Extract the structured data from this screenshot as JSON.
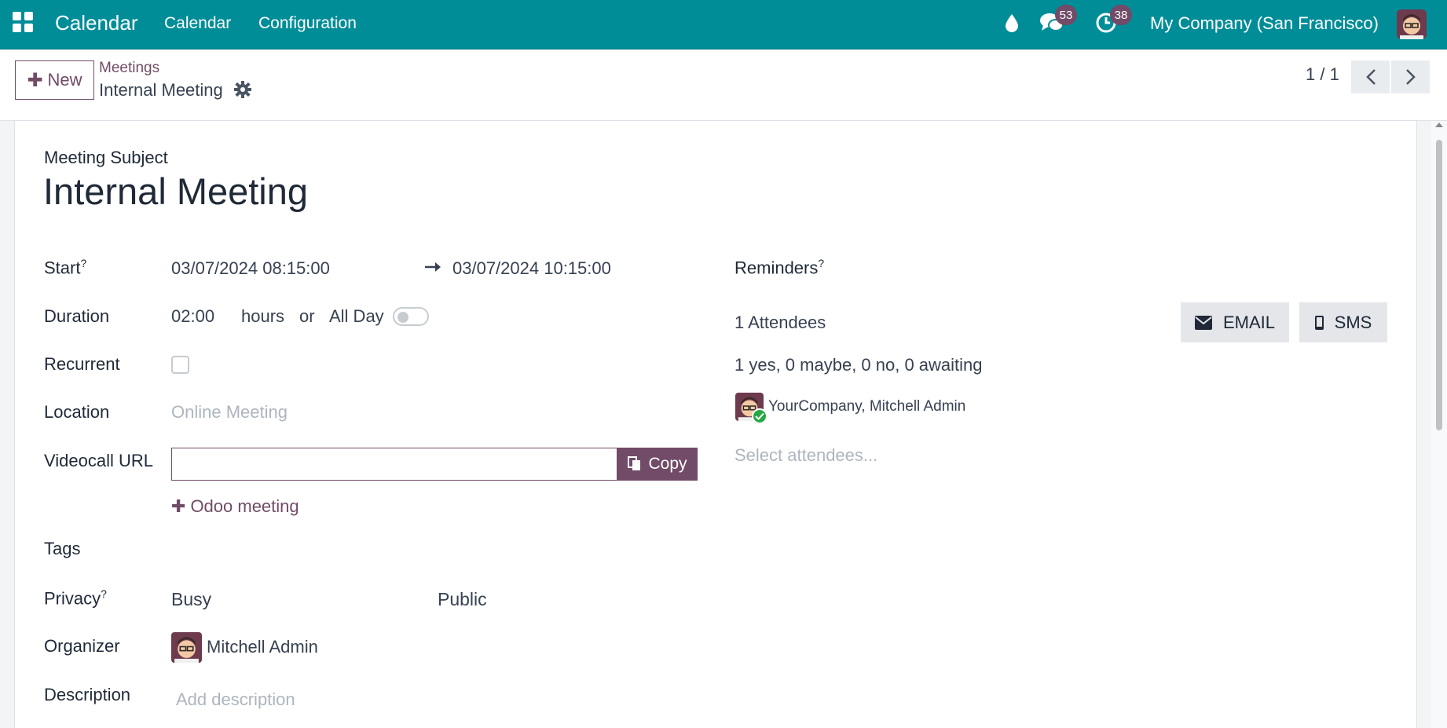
{
  "navbar": {
    "app_title": "Calendar",
    "menu": [
      "Calendar",
      "Configuration"
    ],
    "messages_count": "53",
    "activities_count": "38",
    "company": "My Company (San Francisco)",
    "brand_color": "#018d98",
    "accent_color": "#714b67"
  },
  "control_panel": {
    "new_label": "New",
    "breadcrumb_parent": "Meetings",
    "breadcrumb_current": "Internal Meeting",
    "pager": "1 / 1"
  },
  "form": {
    "subject_label": "Meeting Subject",
    "subject": "Internal Meeting",
    "start_label": "Start",
    "help_mark": "?",
    "start": "03/07/2024 08:15:00",
    "stop": "03/07/2024 10:15:00",
    "duration_label": "Duration",
    "duration": "02:00",
    "hours_label": "hours",
    "or_label": "or",
    "allday_label": "All Day",
    "allday": false,
    "recurrent_label": "Recurrent",
    "recurrent": false,
    "location_label": "Location",
    "location_placeholder": "Online Meeting",
    "videocall_label": "Videocall URL",
    "videocall_value": "",
    "copy_label": "Copy",
    "odoo_meeting_label": "Odoo meeting",
    "tags_label": "Tags",
    "privacy_label": "Privacy",
    "show_as": "Busy",
    "privacy": "Public",
    "organizer_label": "Organizer",
    "organizer": "Mitchell Admin",
    "description_label": "Description",
    "description_placeholder": "Add description"
  },
  "attendees": {
    "reminders_label": "Reminders",
    "count_label": "1 Attendees",
    "email_label": "EMAIL",
    "sms_label": "SMS",
    "summary": "1 yes, 0 maybe, 0 no, 0 awaiting",
    "list": [
      "YourCompany, Mitchell Admin"
    ],
    "select_placeholder": "Select attendees..."
  }
}
